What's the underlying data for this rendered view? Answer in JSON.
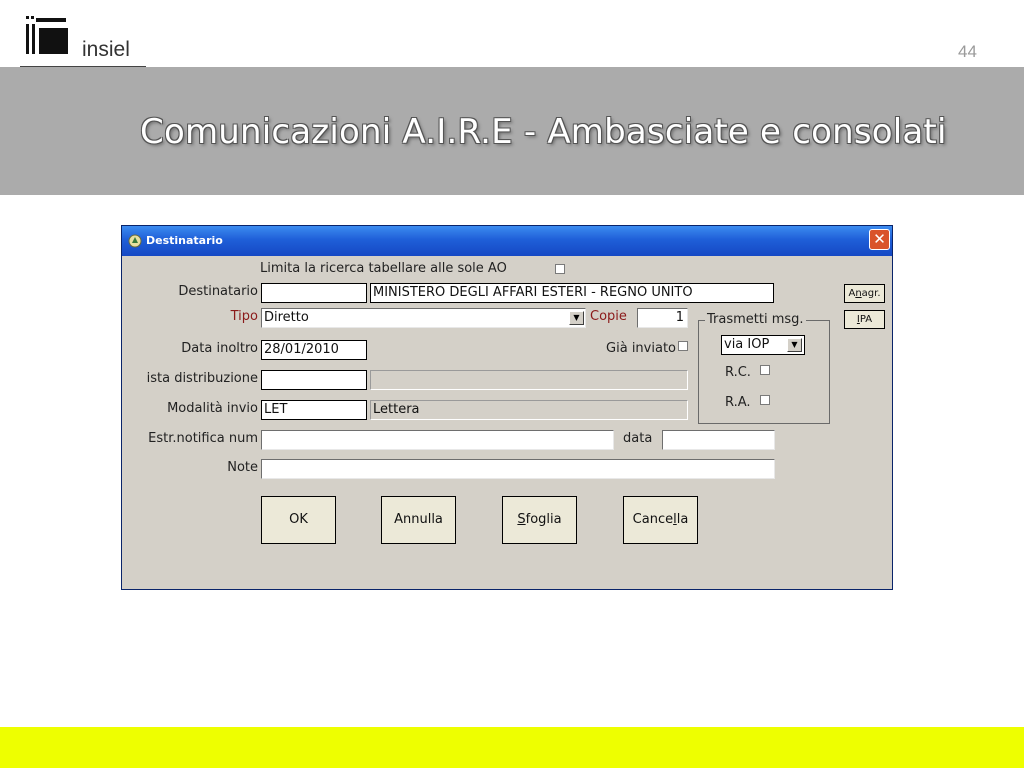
{
  "slide": {
    "brand": "insiel",
    "page_number": "44",
    "title": "Comunicazioni A.I.R.E - Ambasciate e consolati"
  },
  "dialog": {
    "title": "Destinatario",
    "limit_search_label": "Limita la ricerca tabellare alle sole AO",
    "destinatario_label": "Destinatario",
    "destinatario_code": "",
    "destinatario_name": "MINISTERO DEGLI AFFARI ESTERI - REGNO UNITO",
    "tipo_label": "Tipo",
    "tipo_value": "Diretto",
    "copie_label": "Copie",
    "copie_value": "1",
    "trasmetti_label": "Trasmetti msg.",
    "trasmetti_value": "via IOP",
    "data_inoltro_label": "Data inoltro",
    "data_inoltro_value": "28/01/2010",
    "gia_inviato_label": "Già inviato",
    "lista_label": "ista distribuzione",
    "lista_code": "",
    "lista_desc": "",
    "rc_label": "R.C.",
    "ra_label": "R.A.",
    "modalita_label": "Modalità invio",
    "modalita_code": "LET",
    "modalita_desc": "Lettera",
    "estr_label": "Estr.notifica num",
    "estr_value": "",
    "data_label": "data",
    "data_value": "",
    "note_label": "Note",
    "note_value": "",
    "anagr_button": {
      "pre": "A",
      "u": "n",
      "post": "agr."
    },
    "ipa_button": {
      "pre": "",
      "u": "I",
      "post": "PA"
    },
    "ok_button": "OK",
    "annulla_button": "Annulla",
    "sfoglia_button": {
      "pre": "",
      "u": "S",
      "post": "foglia"
    },
    "cancella_button": {
      "pre": "Cance",
      "u": "l",
      "post": "la"
    }
  }
}
